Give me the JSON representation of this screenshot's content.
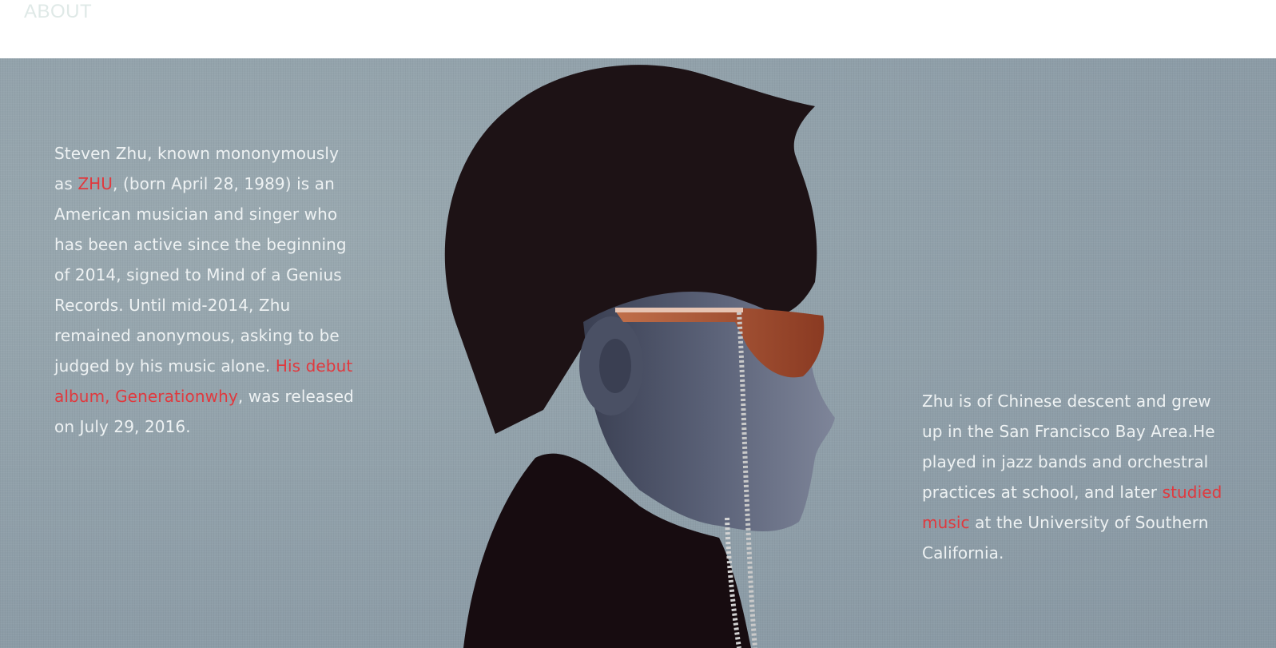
{
  "header": {
    "nav_label": "ABOUT"
  },
  "about": {
    "left": {
      "t1": "Steven Zhu, known mononymously as ",
      "link_zhu": "ZHU",
      "t2": ", (born April 28, 1989) is an American musician and singer who has been active since the beginning of 2014, signed to Mind of a Genius Records. Until mid-2014, Zhu remained anonymous, asking to be judged by his music alone. ",
      "link_album": "His debut album, Generationwhy",
      "t3": ", was released on July 29, 2016."
    },
    "right": {
      "t1": "Zhu is of Chinese descent and grew up in the San Francisco Bay Area.He played in jazz bands and orchestral practices at school, and later ",
      "link_music": "studied music",
      "t2": " at the University of Southern California."
    }
  },
  "colors": {
    "accent": "#e0393e",
    "text": "#eef2f3",
    "background": "#8e9ea8",
    "nav": "#dfe9e7"
  }
}
